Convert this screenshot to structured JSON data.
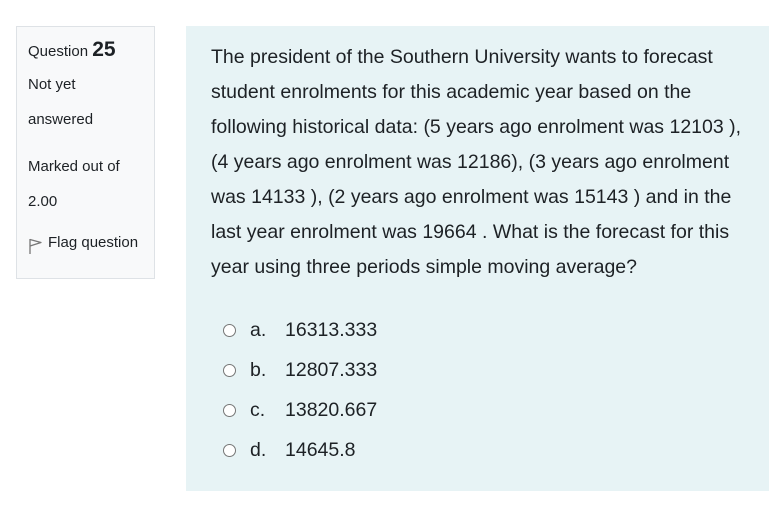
{
  "info": {
    "question_label": "Question",
    "question_number": "25",
    "state_line1": "Not yet",
    "state_line2": "answered",
    "grade_line1": "Marked out of",
    "grade_line2": "2.00",
    "flag_label": "Flag question",
    "flag_icon": "flag-outline-icon"
  },
  "question": {
    "lines": [
      "The president of the Southern University wants to forecast",
      "student enrolments for this academic year based on the",
      "following historical data: (5 years ago enrolment was 12103 ),",
      "(4 years ago enrolment was 12186), (3 years ago enrolment",
      "was 14133 ), (2 years ago enrolment was 15143 ) and in the",
      "last year enrolment was 19664 . What is the forecast for this",
      "year using three periods simple moving average?"
    ]
  },
  "answers": [
    {
      "letter": "a.",
      "value": "16313.333"
    },
    {
      "letter": "b.",
      "value": "12807.333"
    },
    {
      "letter": "c.",
      "value": "13820.667"
    },
    {
      "letter": "d.",
      "value": "14645.8"
    }
  ]
}
